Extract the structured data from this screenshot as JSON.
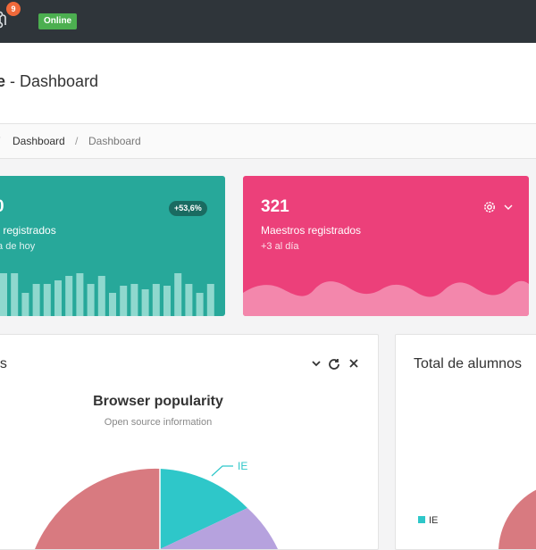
{
  "topbar": {
    "notification_count": "9",
    "status_badge": "Online"
  },
  "header": {
    "title_fragment": "e",
    "title_rest": " - Dashboard"
  },
  "breadcrumb": {
    "items": [
      "Dashboard",
      "Dashboard"
    ]
  },
  "cards": [
    {
      "value_fragment": "0",
      "label_fragment": "s registrados",
      "sub_fragment": "ía de hoy",
      "change_badge": "+53,6%",
      "color": "#27a89a",
      "bar_values": [
        48,
        48,
        26,
        36,
        36,
        40,
        45,
        48,
        36,
        45,
        26,
        34,
        36,
        30,
        36,
        34,
        48,
        36,
        26,
        36
      ]
    },
    {
      "value": "321",
      "label": "Maestros registrados",
      "sub": "+3 al día",
      "color": "#ec407a"
    }
  ],
  "panels": {
    "left": {
      "title_fragment": "as",
      "chart_title": "Browser popularity",
      "chart_subtitle": "Open source information",
      "slice_label": "IE"
    },
    "right": {
      "title": "Total de alumnos",
      "legend_label": "IE"
    }
  },
  "icons": {
    "notification": "git-pull-request-icon",
    "settings": "gear-icon",
    "dropdown": "chevron-down-icon",
    "refresh": "refresh-icon",
    "close": "close-icon"
  },
  "colors": {
    "topbar": "#2f353a",
    "online": "#4caf50",
    "badge": "#f0693a",
    "pie_ie": "#2ec7c9",
    "pie_purple": "#b6a2de",
    "pie_red": "#d87a80"
  }
}
